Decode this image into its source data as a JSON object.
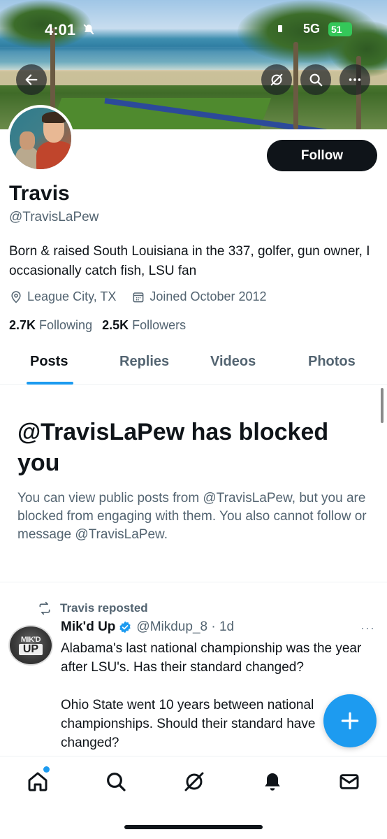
{
  "status_bar": {
    "time": "4:01",
    "network": "5G",
    "battery": "51"
  },
  "profile": {
    "follow_label": "Follow",
    "name": "Travis",
    "handle": "@TravisLaPew",
    "bio": "Born & raised South Louisiana in the 337, golfer, gun owner, I occasionally catch fish, LSU fan",
    "location": "League City, TX",
    "joined": "Joined October 2012",
    "following_count": "2.7K",
    "following_label": "Following",
    "followers_count": "2.5K",
    "followers_label": "Followers"
  },
  "tabs": [
    {
      "label": "Posts",
      "active": true
    },
    {
      "label": "Replies",
      "active": false
    },
    {
      "label": "Videos",
      "active": false
    },
    {
      "label": "Photos",
      "active": false
    }
  ],
  "blocked": {
    "title": "@TravisLaPew has blocked you",
    "message": "You can view public posts from @TravisLaPew, but you are blocked from engaging with them. You also cannot follow or message @TravisLaPew."
  },
  "post": {
    "repost_label": "Travis reposted",
    "avatar_line1": "MIK'D",
    "avatar_line2": "UP",
    "display_name": "Mik'd Up",
    "handle_time": "@Mikdup_8 · 1d",
    "more": "···",
    "text": "Alabama's last national championship was the year after LSU's. Has their standard changed?\n\nOhio State went 10 years between national championships. Should their standard have changed?"
  },
  "icons": {
    "back": "arrow-left-icon",
    "grok": "grok-icon",
    "search": "search-icon",
    "more": "more-icon",
    "location": "location-pin-icon",
    "calendar": "calendar-icon",
    "repost": "repost-icon",
    "verified": "verified-badge-icon",
    "compose": "plus-icon",
    "home": "home-icon",
    "explore": "search-icon",
    "grok_nav": "grok-icon",
    "notifications": "bell-icon",
    "messages": "mail-icon"
  },
  "colors": {
    "accent": "#1d9bf0",
    "text": "#0f1419",
    "secondary": "#536471"
  }
}
